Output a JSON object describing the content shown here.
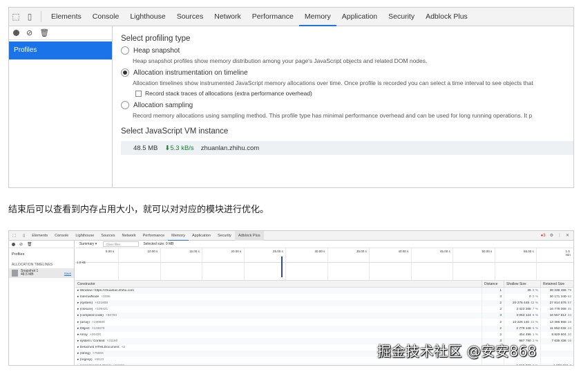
{
  "panel1": {
    "tabs": [
      "Elements",
      "Console",
      "Lighthouse",
      "Sources",
      "Network",
      "Performance",
      "Memory",
      "Application",
      "Security",
      "Adblock Plus"
    ],
    "active_tab": "Memory",
    "sidebar_item": "Profiles",
    "section_title": "Select profiling type",
    "options": [
      {
        "title": "Heap snapshot",
        "desc": "Heap snapshot profiles show memory distribution among your page's JavaScript objects and related DOM nodes.",
        "selected": false
      },
      {
        "title": "Allocation instrumentation on timeline",
        "desc": "Allocation timelines show instrumented JavaScript memory allocations over time. Once profile is recorded you can select a time interval to see objects that",
        "selected": true
      },
      {
        "title": "Allocation sampling",
        "desc": "Record memory allocations using sampling method. This profile type has minimal performance overhead and can be used for long running operations. It p",
        "selected": false
      }
    ],
    "checkbox_label": "Record stack traces of allocations (extra performance overhead)",
    "vm_title": "Select JavaScript VM instance",
    "vm": {
      "size": "48.5 MB",
      "rate": "5.3 kB/s",
      "host": "zhuanlan.zhihu.com"
    }
  },
  "caption": "结束后可以查看到内存占用大小，就可以对对应的模块进行优化。",
  "panel2": {
    "tabs": [
      "Elements",
      "Console",
      "Lighthouse",
      "Sources",
      "Network",
      "Performance",
      "Memory",
      "Application",
      "Security",
      "Adblock Plus"
    ],
    "active_tab": "Memory",
    "error_count": "3",
    "sidebar": {
      "profiles": "Profiles",
      "section": "ALLOCATION TIMELINES",
      "snapshot_name": "Snapshot 1",
      "snapshot_size": "48.5 MB",
      "save": "Save"
    },
    "toolbar": {
      "view": "Summary",
      "filter_placeholder": "Class filter",
      "selected_size": "Selected size: 0 MB"
    },
    "timeline": {
      "ticks": [
        "5.00 s",
        "10.00 s",
        "15.00 s",
        "20.00 s",
        "25.00 s",
        "30.00 s",
        "35.00 s",
        "40.00 s",
        "45.00 s",
        "50.00 s",
        "55.00 s",
        "1.0 min"
      ],
      "mb_label": "1.0 kB"
    },
    "columns": {
      "constructor": "Constructor",
      "distance": "Distance",
      "shallow": "Shallow Size",
      "retained": "Retained Size"
    },
    "rows": [
      {
        "name": "Window / https://zhuanlan.zhihu.com",
        "count": "",
        "distance": "1",
        "shallow": "36",
        "shallow_pct": "0 %",
        "retained": "38 336 456",
        "retained_pct": "79"
      },
      {
        "name": "InternalNode",
        "count": "×1086",
        "distance": "3",
        "shallow": "0",
        "shallow_pct": "0 %",
        "retained": "30 171 340",
        "retained_pct": "62"
      },
      {
        "name": "(system)",
        "count": "×421808",
        "distance": "2",
        "shallow": "20 276 448",
        "shallow_pct": "42 %",
        "retained": "27 814 676",
        "retained_pct": "57"
      },
      {
        "name": "(closure)",
        "count": "×109421",
        "distance": "2",
        "shallow": "3 423 268",
        "shallow_pct": "7 %",
        "retained": "16 779 068",
        "retained_pct": "35"
      },
      {
        "name": "(compiled code)",
        "count": "×56793",
        "distance": "3",
        "shallow": "3 053 124",
        "shallow_pct": "6 %",
        "retained": "16 557 812",
        "retained_pct": "34"
      },
      {
        "name": "(array)",
        "count": "×190889",
        "distance": "2",
        "shallow": "10 226 140",
        "shallow_pct": "21 %",
        "retained": "13 386 868",
        "retained_pct": "28"
      },
      {
        "name": "Object",
        "count": "×103670",
        "distance": "2",
        "shallow": "2 779 148",
        "shallow_pct": "6 %",
        "retained": "11 852 032",
        "retained_pct": "24"
      },
      {
        "name": "Array",
        "count": "×26400",
        "distance": "2",
        "shallow": "454 496",
        "shallow_pct": "1 %",
        "retained": "9 929 604",
        "retained_pct": "20"
      },
      {
        "name": "system / Context",
        "count": "×31150",
        "distance": "3",
        "shallow": "987 780",
        "shallow_pct": "2 %",
        "retained": "7 635 436",
        "retained_pct": "16"
      },
      {
        "name": "Detached HTMLDocument",
        "count": "×2",
        "distance": "",
        "shallow": "",
        "shallow_pct": "",
        "retained": "",
        "retained_pct": ""
      },
      {
        "name": "(string)",
        "count": "×75604",
        "distance": "",
        "shallow": "",
        "shallow_pct": "",
        "retained": "",
        "retained_pct": ""
      },
      {
        "name": "(regexp)",
        "count": "×5613",
        "distance": "",
        "shallow": "",
        "shallow_pct": "",
        "retained": "",
        "retained_pct": ""
      },
      {
        "name": "(concatenated string)",
        "count": "×59890",
        "distance": "",
        "shallow": "1 019 800",
        "shallow_pct": "2 %",
        "retained": "1 888 316",
        "retained_pct": "3"
      }
    ]
  },
  "watermark": "掘金技术社区 @安安868"
}
